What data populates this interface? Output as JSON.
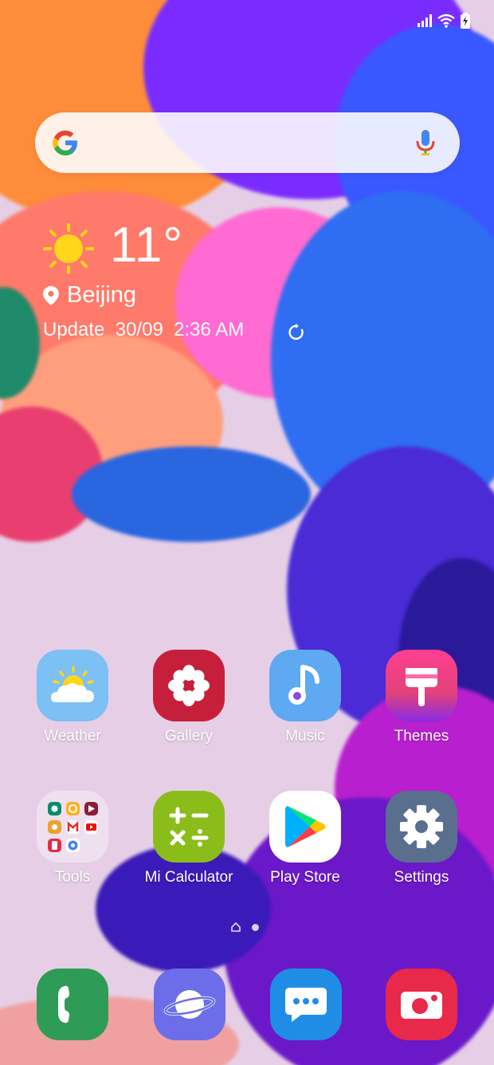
{
  "search": {
    "logo": "google-g-icon",
    "mic": "microphone-icon"
  },
  "weather": {
    "temperature": "11°",
    "location": "Beijing",
    "update_label": "Update",
    "update_date": "30/09",
    "update_time": "2:36 AM"
  },
  "apps_row1": [
    {
      "label": "Weather"
    },
    {
      "label": "Gallery"
    },
    {
      "label": "Music"
    },
    {
      "label": "Themes"
    }
  ],
  "apps_row2": [
    {
      "label": "Tools"
    },
    {
      "label": "Mi Calculator"
    },
    {
      "label": "Play Store"
    },
    {
      "label": "Settings"
    }
  ],
  "dock": [
    {
      "icon": "phone-icon"
    },
    {
      "icon": "internet-planet-icon"
    },
    {
      "icon": "messages-icon"
    },
    {
      "icon": "camera-icon"
    }
  ],
  "colors": {
    "weather": "#7cc0f4",
    "gallery": "#c61f3c",
    "music": "#5ea9f2",
    "themes_top": "#ff3f92",
    "themes_bottom": "#8a2be2",
    "calculator": "#8bbd1a",
    "settings": "#5a6f8d",
    "phone": "#2e9c56",
    "internet": "#6b6ee8",
    "messages": "#1f8de6",
    "camera": "#e8294a"
  }
}
